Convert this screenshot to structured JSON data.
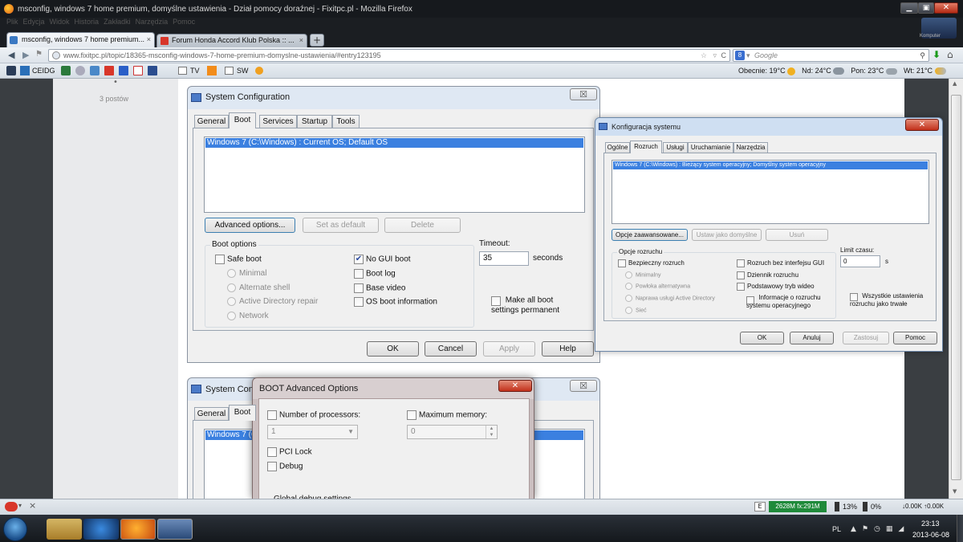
{
  "firefox": {
    "window_title": "msconfig, windows 7 home premium, domyślne ustawienia - Dział pomocy doraźnej - Fixitpc.pl - Mozilla Firefox",
    "menu": [
      "Plik",
      "Edycja",
      "Widok",
      "Historia",
      "Zakładki",
      "Narzędzia",
      "Pomoc"
    ],
    "tabs": [
      {
        "label": "msconfig, windows 7 home premium...",
        "close": "×"
      },
      {
        "label": "Forum Honda Accord Klub Polska :: ...",
        "close": "×"
      }
    ],
    "new_tab": "+",
    "url": "www.fixitpc.pl/topic/18365-msconfig-windows-7-home-premium-domyslne-ustawienia/#entry123195",
    "search_engine": "8",
    "search_placeholder": "Google",
    "bookmarks": [
      "CEIDG",
      "TV",
      "SW"
    ],
    "weather": [
      "Obecnie: 19°C",
      "Nd: 24°C",
      "Pon: 23°C",
      "Wt: 21°C"
    ],
    "corner_label": "Komputer"
  },
  "page": {
    "posts": "3 postów",
    "bullet": "•"
  },
  "sysconfig": {
    "title": "System Configuration",
    "close": "☒",
    "tabs": [
      "General",
      "Boot",
      "Services",
      "Startup",
      "Tools"
    ],
    "os_entry": "Windows 7 (C:\\Windows) : Current OS; Default OS",
    "buttons": {
      "advanced": "Advanced options...",
      "set_default": "Set as default",
      "delete": "Delete"
    },
    "boot_options_label": "Boot options",
    "safe_boot": "Safe boot",
    "safe_sub": [
      "Minimal",
      "Alternate shell",
      "Active Directory repair",
      "Network"
    ],
    "right_opts": [
      {
        "label": "No GUI boot",
        "checked": "✔"
      },
      {
        "label": "Boot log",
        "checked": ""
      },
      {
        "label": "Base video",
        "checked": ""
      },
      {
        "label": "OS boot information",
        "checked": ""
      }
    ],
    "timeout_label": "Timeout:",
    "timeout_value": "35",
    "seconds": "seconds",
    "make_permanent": "Make all boot settings permanent",
    "bottom_buttons": {
      "ok": "OK",
      "cancel": "Cancel",
      "apply": "Apply",
      "help": "Help"
    }
  },
  "konfig": {
    "title": "Konfiguracja systemu",
    "close": "✕",
    "tabs": [
      "Ogólne",
      "Rozruch",
      "Usługi",
      "Uruchamianie",
      "Narzędzia"
    ],
    "os_entry": "Windows 7 (C:\\Windows) : Bieżący system operacyjny; Domyślny system operacyjny",
    "buttons": {
      "advanced": "Opcje zaawansowane...",
      "set_default": "Ustaw jako domyślne",
      "delete": "Usuń"
    },
    "boot_options_label": "Opcje rozruchu",
    "safe_boot": "Bezpieczny rozruch",
    "safe_sub": [
      "Minimalny",
      "Powłoka alternatywna",
      "Naprawa usługi Active Directory",
      "Sieć"
    ],
    "right_opts": [
      "Rozruch bez interfejsu GUI",
      "Dziennik rozruchu",
      "Podstawowy tryb wideo",
      "Informacje o rozruchu systemu operacyjnego"
    ],
    "timeout_label": "Limit czasu:",
    "timeout_value": "0",
    "seconds": "s",
    "make_permanent": "Wszystkie ustawienia rozruchu jako trwałe",
    "bottom_buttons": {
      "ok": "OK",
      "cancel": "Anuluj",
      "apply": "Zastosuj",
      "help": "Pomoc"
    }
  },
  "sysconfig2": {
    "title": "System Conf",
    "tabs": [
      "General",
      "Boot"
    ],
    "os_entry": "Windows 7 (C",
    "close": "☒"
  },
  "bootadv": {
    "title": "BOOT Advanced Options",
    "close": "✕",
    "num_proc": "Number of processors:",
    "num_proc_value": "1",
    "max_mem": "Maximum memory:",
    "max_mem_value": "0",
    "pci_lock": "PCI Lock",
    "debug": "Debug",
    "global_debug": "Global debug settings"
  },
  "statusbar": {
    "close": "×",
    "mem": "2628M fx:291M",
    "cpu1": "13%",
    "cpu2": "0%",
    "net": "↓0.00K ↑0.00K"
  },
  "taskbar": {
    "lang": "PL",
    "time": "23:13",
    "date": "2013-06-08"
  }
}
